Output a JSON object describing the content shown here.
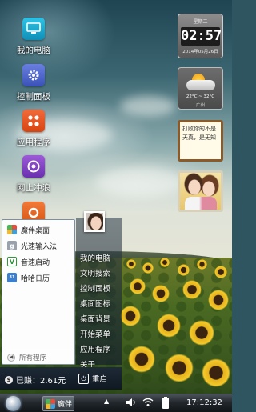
{
  "desktop_icons": [
    {
      "label": "我的电脑",
      "icon": "computer-icon"
    },
    {
      "label": "控制面板",
      "icon": "control-panel-icon"
    },
    {
      "label": "应用程序",
      "icon": "apps-icon"
    },
    {
      "label": "网上冲浪",
      "icon": "browser-icon"
    }
  ],
  "widgets": {
    "clock": {
      "weekday": "星期二",
      "time": "02:57",
      "date": "2014年05月26日"
    },
    "weather": {
      "range": "22°C ~ 32°C",
      "location": "广州"
    },
    "note": {
      "text": "打败你的不是天真，是无知"
    }
  },
  "start_menu": {
    "left_items": [
      {
        "label": "魔伴桌面",
        "icon": "mobanlauncher-icon"
      },
      {
        "label": "光速输入法",
        "icon": "input-method-icon"
      },
      {
        "label": "音速启动",
        "icon": "quick-launch-icon"
      },
      {
        "label": "哈哈日历",
        "icon": "calendar-icon"
      }
    ],
    "all_programs": "所有程序",
    "right_links": [
      "我的电脑",
      "文明搜索",
      "控制面板",
      "桌面图标",
      "桌面背景",
      "开始菜单",
      "应用程序",
      "关于"
    ],
    "earned": "已赚：2.61元",
    "restart": "重启"
  },
  "taskbar": {
    "app_label": "魔伴",
    "time": "17:12:32"
  },
  "colors": {
    "taskbar": "#1b2025",
    "menu_border": "#7d8ea0"
  }
}
